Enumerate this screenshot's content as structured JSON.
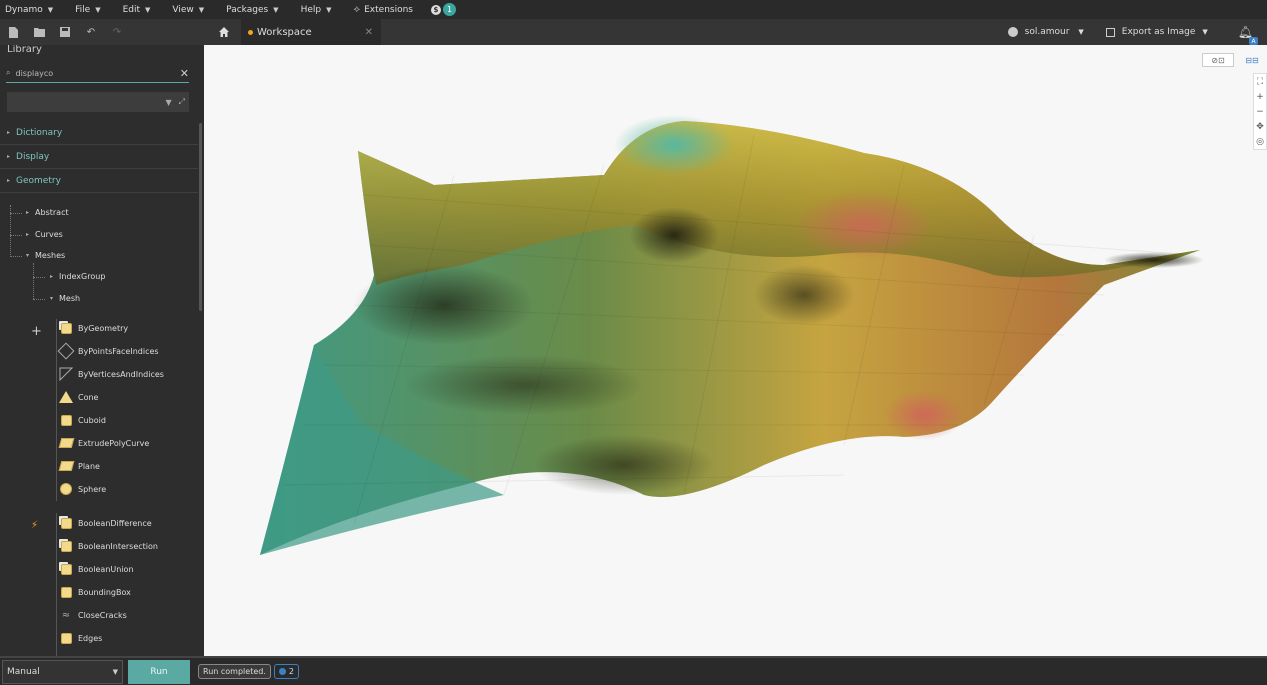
{
  "menubar": {
    "items": [
      {
        "label": "Dynamo"
      },
      {
        "label": "File"
      },
      {
        "label": "Edit"
      },
      {
        "label": "View"
      },
      {
        "label": "Packages"
      },
      {
        "label": "Help"
      }
    ],
    "extensions_label": "Extensions",
    "notification_count": "1"
  },
  "toolbar": {
    "tab_label": "Workspace",
    "user_label": "sol.amour",
    "export_label": "Export as Image",
    "bell_badge": "A"
  },
  "library": {
    "title": "Library",
    "search_value": "displayco",
    "categories": [
      {
        "label": "Dictionary"
      },
      {
        "label": "Display"
      },
      {
        "label": "Geometry"
      }
    ],
    "subcategories": {
      "abstract": "Abstract",
      "curves": "Curves",
      "meshes": "Meshes",
      "index_group": "IndexGroup",
      "mesh": "Mesh"
    },
    "create_nodes": [
      {
        "label": "ByGeometry",
        "icon": "cube2"
      },
      {
        "label": "ByPointsFaceIndices",
        "icon": "wire"
      },
      {
        "label": "ByVerticesAndIndices",
        "icon": "tri-outline"
      },
      {
        "label": "Cone",
        "icon": "tri"
      },
      {
        "label": "Cuboid",
        "icon": "cube"
      },
      {
        "label": "ExtrudePolyCurve",
        "icon": "plane"
      },
      {
        "label": "Plane",
        "icon": "plane"
      },
      {
        "label": "Sphere",
        "icon": "ball"
      }
    ],
    "action_nodes": [
      {
        "label": "BooleanDifference",
        "icon": "cube2"
      },
      {
        "label": "BooleanIntersection",
        "icon": "cube2"
      },
      {
        "label": "BooleanUnion",
        "icon": "cube2"
      },
      {
        "label": "BoundingBox",
        "icon": "cube"
      },
      {
        "label": "CloseCracks",
        "icon": "crack"
      },
      {
        "label": "Edges",
        "icon": "cube"
      }
    ]
  },
  "statusbar": {
    "run_mode": "Manual",
    "run_label": "Run",
    "status_text": "Run completed.",
    "info_count": "2"
  }
}
